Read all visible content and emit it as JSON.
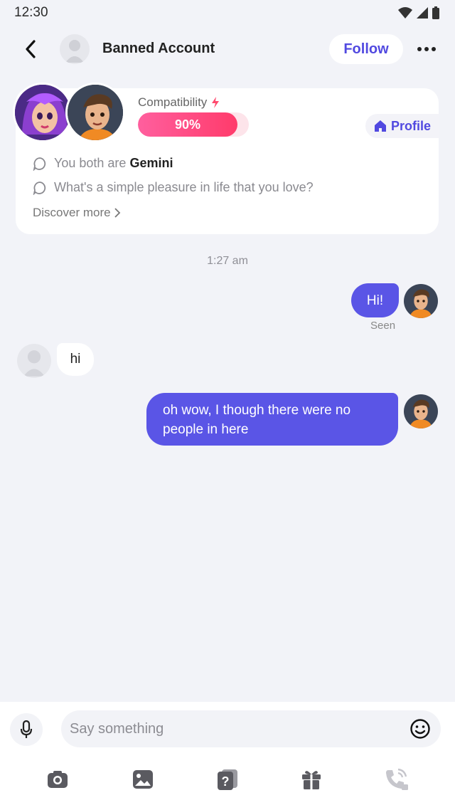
{
  "status_bar": {
    "time": "12:30"
  },
  "header": {
    "name": "Banned Account",
    "follow_label": "Follow"
  },
  "match_card": {
    "compatibility_label": "Compatibility",
    "compatibility_value": "90%",
    "compatibility_fraction": 0.9,
    "profile_label": "Profile",
    "topics": [
      {
        "prefix": "You both are ",
        "highlight": "Gemini"
      },
      {
        "prefix": "What's a simple pleasure in life that you love?",
        "highlight": ""
      }
    ],
    "discover_label": "Discover more"
  },
  "chat": {
    "timestamp": "1:27 am",
    "messages": [
      {
        "direction": "out",
        "text": "Hi!",
        "status": "Seen"
      },
      {
        "direction": "in",
        "text": "hi"
      },
      {
        "direction": "out",
        "text": "oh wow, I though there were no people in here"
      }
    ]
  },
  "composer": {
    "placeholder": "Say something"
  },
  "toolbar": {
    "icons": [
      "camera-icon",
      "image-icon",
      "question-card-icon",
      "gift-icon",
      "phone-call-icon"
    ]
  },
  "colors": {
    "accent": "#5149e0",
    "bubble_out": "#5a55e6",
    "compat_fill": "#ff3b6b",
    "background": "#f2f3f8"
  }
}
